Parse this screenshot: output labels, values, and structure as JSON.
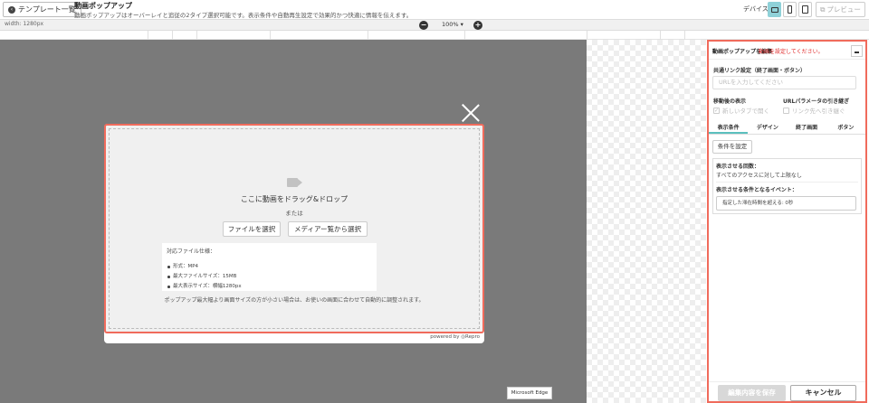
{
  "header": {
    "back_label": "テンプレート一覧",
    "title": "動画ポップアップ",
    "description": "動画ポップアップはオーバーレイと追従の2タイプ選択可能です。表示条件や自動再生設定で効果的かつ快適に情報を伝えます。",
    "device_label": "デバイス",
    "preview_label": "プレビュー"
  },
  "toolbar": {
    "width_text": "width: 1280px",
    "zoom_text": "100% ▾",
    "zoom_minus": "−",
    "zoom_plus": "+"
  },
  "popup": {
    "drop_text": "ここに動画をドラッグ&ドロップ",
    "or_text": "または",
    "select_file": "ファイルを選択",
    "select_media": "メディアー覧から選択",
    "spec_title": "対応ファイル仕様：",
    "spec_items": [
      "形式：MP4",
      "最大ファイルサイズ：15MB",
      "最大表示サイズ：横幅1280px"
    ],
    "note": "ポップアップ最大幅より画面サイズの方が小さい場合は、お使いの画面に合わせて自動的に調整されます。",
    "powered": "powered by ◎Repro"
  },
  "browser_badge": "Microsoft Edge",
  "panel": {
    "title": "動画ポップアップを編集",
    "warning": "動画を設定してください。",
    "link_label": "共通リンク設定（終了画面・ボタン）",
    "url_placeholder": "URLを入力してください",
    "after_move_label": "移動後の表示",
    "new_tab_label": "新しいタブで開く",
    "url_param_label": "URLパラメータの引き継ぎ",
    "link_forward_label": "リンク先へ引き継ぐ",
    "tabs": [
      "表示条件",
      "デザイン",
      "終了画面",
      "ボタン"
    ],
    "condition_button": "条件を設定",
    "times_label": "表示させる回数：",
    "times_value": "すべてのアクセスに対して上限なし",
    "event_label": "表示させる条件となるイベント：",
    "event_value": "指定した滞在時間を超える: 0秒",
    "save_label": "編集内容を保存",
    "cancel_label": "キャンセル"
  },
  "colors": {
    "accent_red": "#f06b5c",
    "tab_underline": "#5bc0be",
    "device_active": "#8fd1d8"
  }
}
